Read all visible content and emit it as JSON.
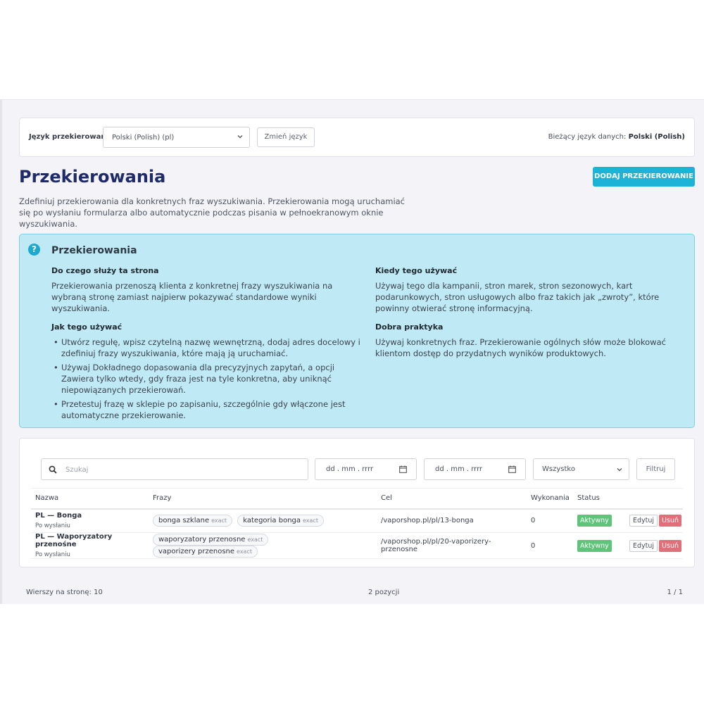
{
  "language_bar": {
    "label": "Język przekierowań",
    "selected_language": "Polski (Polish) (pl)",
    "change_button": "Zmień język",
    "current_prefix": "Bieżący język danych:",
    "current_value": "Polski (Polish)"
  },
  "page": {
    "title": "Przekierowania",
    "add_button": "DODAJ PRZEKIEROWANIE",
    "intro": "Zdefiniuj przekierowania dla konkretnych fraz wyszukiwania. Przekierowania mogą uruchamiać się po wysłaniu formularza albo automatycznie podczas pisania w pełnoekranowym oknie wyszukiwania."
  },
  "info_panel": {
    "title": "Przekierowania",
    "what_title": "Do czego służy ta strona",
    "what_text": "Przekierowania przenoszą klienta z konkretnej frazy wyszukiwania na wybraną stronę zamiast najpierw pokazywać standardowe wyniki wyszukiwania.",
    "how_title": "Jak tego używać",
    "how_items": [
      "Utwórz regułę, wpisz czytelną nazwę wewnętrzną, dodaj adres docelowy i zdefiniuj frazy wyszukiwania, które mają ją uruchamiać.",
      "Używaj Dokładnego dopasowania dla precyzyjnych zapytań, a opcji Zawiera tylko wtedy, gdy fraza jest na tyle konkretna, aby uniknąć niepowiązanych przekierowań.",
      "Przetestuj frazę w sklepie po zapisaniu, szczególnie gdy włączone jest automatyczne przekierowanie."
    ],
    "when_title": "Kiedy tego używać",
    "when_text": "Używaj tego dla kampanii, stron marek, stron sezonowych, kart podarunkowych, stron usługowych albo fraz takich jak „zwroty”, które powinny otwierać stronę informacyjną.",
    "best_title": "Dobra praktyka",
    "best_text": "Używaj konkretnych fraz. Przekierowanie ogólnych słów może blokować klientom dostęp do przydatnych wyników produktowych."
  },
  "filters": {
    "search_placeholder": "Szukaj",
    "date_from": "dd . mm . rrrr",
    "date_to": "dd . mm . rrrr",
    "status_value": "Wszystko",
    "filter_button": "Filtruj"
  },
  "table": {
    "headers": [
      "Nazwa",
      "Frazy",
      "Cel",
      "Wykonania",
      "Status",
      ""
    ],
    "rows": [
      {
        "name": "PL — Bonga",
        "trigger": "Po wysłaniu",
        "phrases": [
          {
            "text": "bonga szklane",
            "match": "exact"
          },
          {
            "text": "kategoria bonga",
            "match": "exact"
          }
        ],
        "target": "/vaporshop.pl/pl/13-bonga",
        "executions": "0",
        "status": "Aktywny",
        "edit": "Edytuj",
        "delete": "Usuń"
      },
      {
        "name": "PL — Waporyzatory przenośne",
        "trigger": "Po wysłaniu",
        "phrases": [
          {
            "text": "waporyzatory przenosne",
            "match": "exact"
          },
          {
            "text": "vaporizery przenosne",
            "match": "exact"
          }
        ],
        "target": "/vaporshop.pl/pl/20-vaporizery-przenosne",
        "executions": "0",
        "status": "Aktywny",
        "edit": "Edytuj",
        "delete": "Usuń"
      }
    ]
  },
  "footer": {
    "rows_per_page": "Wierszy na stronę: 10",
    "count": "2 pozycji",
    "pages": "1 / 1"
  },
  "colors": {
    "title": "#1f2a6b",
    "accent": "#1cb3d6",
    "info_bg": "#bfe9f4",
    "status_active": "#5ec47a",
    "delete": "#e06f79"
  }
}
